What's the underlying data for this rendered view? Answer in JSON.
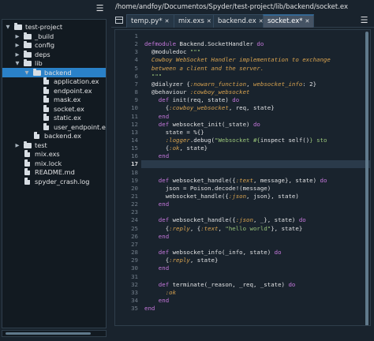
{
  "explorer": {
    "menu_icon": "hamburger-menu-icon",
    "tree": [
      {
        "label": "test-project",
        "depth": 0,
        "type": "folder",
        "expanded": true
      },
      {
        "label": "_build",
        "depth": 1,
        "type": "folder",
        "expanded": false
      },
      {
        "label": "config",
        "depth": 1,
        "type": "folder",
        "expanded": false
      },
      {
        "label": "deps",
        "depth": 1,
        "type": "folder",
        "expanded": false
      },
      {
        "label": "lib",
        "depth": 1,
        "type": "folder",
        "expanded": true
      },
      {
        "label": "backend",
        "depth": 2,
        "type": "folder",
        "expanded": true,
        "selected": true
      },
      {
        "label": "application.ex",
        "depth": 3,
        "type": "file"
      },
      {
        "label": "endpoint.ex",
        "depth": 3,
        "type": "file"
      },
      {
        "label": "mask.ex",
        "depth": 3,
        "type": "file"
      },
      {
        "label": "socket.ex",
        "depth": 3,
        "type": "file"
      },
      {
        "label": "static.ex",
        "depth": 3,
        "type": "file"
      },
      {
        "label": "user_endpoint.ex",
        "depth": 3,
        "type": "file"
      },
      {
        "label": "backend.ex",
        "depth": 2,
        "type": "file"
      },
      {
        "label": "test",
        "depth": 1,
        "type": "folder",
        "expanded": false
      },
      {
        "label": "mix.exs",
        "depth": 1,
        "type": "file"
      },
      {
        "label": "mix.lock",
        "depth": 1,
        "type": "file"
      },
      {
        "label": "README.md",
        "depth": 1,
        "type": "file"
      },
      {
        "label": "spyder_crash.log",
        "depth": 1,
        "type": "file"
      }
    ]
  },
  "editor": {
    "path": "/home/andfoy/Documentos/Spyder/test-project/lib/backend/socket.ex",
    "browse_icon": "browse-tabs-icon",
    "menu_icon": "hamburger-menu-icon",
    "tabs": [
      {
        "label": "temp.py*",
        "active": false
      },
      {
        "label": "mix.exs",
        "active": false
      },
      {
        "label": "backend.ex",
        "active": false
      },
      {
        "label": "socket.ex*",
        "active": true
      }
    ],
    "current_line": 17,
    "lines": [
      {
        "n": "1",
        "parts": []
      },
      {
        "n": "2",
        "parts": [
          [
            "defmodule ",
            "kw"
          ],
          [
            "Backend.SocketHandler ",
            "mod"
          ],
          [
            "do",
            "kw"
          ]
        ]
      },
      {
        "n": "3",
        "parts": [
          [
            "  @moduledoc ",
            "attr"
          ],
          [
            "\"\"\"",
            "str"
          ]
        ]
      },
      {
        "n": "4",
        "parts": [
          [
            "  Cowboy WebSocket Handler implementation to exchange",
            "doc"
          ]
        ]
      },
      {
        "n": "5",
        "parts": [
          [
            "  between a client and the server.",
            "doc"
          ]
        ]
      },
      {
        "n": "6",
        "parts": [
          [
            "  \"\"\"",
            "str"
          ]
        ]
      },
      {
        "n": "7",
        "parts": [
          [
            "  @dialyzer {",
            "attr"
          ],
          [
            ":nowarn_function",
            "atom"
          ],
          [
            ", ",
            "txt"
          ],
          [
            "websocket_info",
            "atom"
          ],
          [
            ": 2}",
            "txt"
          ]
        ]
      },
      {
        "n": "8",
        "parts": [
          [
            "  @behaviour ",
            "attr"
          ],
          [
            ":cowboy_websocket",
            "atom"
          ]
        ]
      },
      {
        "n": "9",
        "parts": [
          [
            "    def ",
            "kw"
          ],
          [
            "init(req, state) ",
            "txt"
          ],
          [
            "do",
            "kw"
          ]
        ]
      },
      {
        "n": "10",
        "parts": [
          [
            "      {",
            "txt"
          ],
          [
            ":cowboy_websocket",
            "atom"
          ],
          [
            ", req, state}",
            "txt"
          ]
        ]
      },
      {
        "n": "11",
        "parts": [
          [
            "    end",
            "kw"
          ]
        ]
      },
      {
        "n": "12",
        "parts": [
          [
            "    def ",
            "kw"
          ],
          [
            "websocket_init(_state) ",
            "txt"
          ],
          [
            "do",
            "kw"
          ]
        ]
      },
      {
        "n": "13",
        "parts": [
          [
            "      state = %{}",
            "txt"
          ]
        ]
      },
      {
        "n": "14",
        "parts": [
          [
            "      :logger",
            "atom"
          ],
          [
            ".debug(",
            "txt"
          ],
          [
            "\"Websocket #{",
            "str"
          ],
          [
            "inspect self()",
            "txt"
          ],
          [
            "} sto",
            "str"
          ]
        ]
      },
      {
        "n": "15",
        "parts": [
          [
            "      {",
            "txt"
          ],
          [
            ":ok",
            "atom"
          ],
          [
            ", state}",
            "txt"
          ]
        ]
      },
      {
        "n": "16",
        "parts": [
          [
            "    end",
            "kw"
          ]
        ]
      },
      {
        "n": "17",
        "parts": []
      },
      {
        "n": "18",
        "parts": []
      },
      {
        "n": "19",
        "parts": [
          [
            "    def ",
            "kw"
          ],
          [
            "websocket_handle({",
            "txt"
          ],
          [
            ":text",
            "atom"
          ],
          [
            ", message}, state) ",
            "txt"
          ],
          [
            "do",
            "kw"
          ]
        ]
      },
      {
        "n": "20",
        "parts": [
          [
            "      json = Poison.decode!(message)",
            "txt"
          ]
        ]
      },
      {
        "n": "21",
        "parts": [
          [
            "      websocket_handle({",
            "txt"
          ],
          [
            ":json",
            "atom"
          ],
          [
            ", json}, state)",
            "txt"
          ]
        ]
      },
      {
        "n": "22",
        "parts": [
          [
            "    end",
            "kw"
          ]
        ]
      },
      {
        "n": "23",
        "parts": []
      },
      {
        "n": "24",
        "parts": [
          [
            "    def ",
            "kw"
          ],
          [
            "websocket_handle({",
            "txt"
          ],
          [
            ":json",
            "atom"
          ],
          [
            ", _}, state) ",
            "txt"
          ],
          [
            "do",
            "kw"
          ]
        ]
      },
      {
        "n": "25",
        "parts": [
          [
            "      {",
            "txt"
          ],
          [
            ":reply",
            "atom"
          ],
          [
            ", {",
            "txt"
          ],
          [
            ":text",
            "atom"
          ],
          [
            ", ",
            "txt"
          ],
          [
            "\"hello world\"",
            "str"
          ],
          [
            "}, state}",
            "txt"
          ]
        ]
      },
      {
        "n": "26",
        "parts": [
          [
            "    end",
            "kw"
          ]
        ]
      },
      {
        "n": "27",
        "parts": []
      },
      {
        "n": "28",
        "parts": [
          [
            "    def ",
            "kw"
          ],
          [
            "websocket_info(_info, state) ",
            "txt"
          ],
          [
            "do",
            "kw"
          ]
        ]
      },
      {
        "n": "29",
        "parts": [
          [
            "      {",
            "txt"
          ],
          [
            ":reply",
            "atom"
          ],
          [
            ", state}",
            "txt"
          ]
        ]
      },
      {
        "n": "30",
        "parts": [
          [
            "    end",
            "kw"
          ]
        ]
      },
      {
        "n": "31",
        "parts": []
      },
      {
        "n": "32",
        "parts": [
          [
            "    def ",
            "kw"
          ],
          [
            "terminate(_reason, _req, _state) ",
            "txt"
          ],
          [
            "do",
            "kw"
          ]
        ]
      },
      {
        "n": "33",
        "parts": [
          [
            "      :ok",
            "atom"
          ]
        ]
      },
      {
        "n": "34",
        "parts": [
          [
            "    end",
            "kw"
          ]
        ]
      },
      {
        "n": "35",
        "parts": [
          [
            "end",
            "kw"
          ]
        ]
      }
    ],
    "colors": {
      "kw": "#c678dd",
      "mod": "#e0e1e3",
      "attr": "#e0e1e3",
      "str": "#98c379",
      "doc": "#d7a24f",
      "atom": "#d7a24f",
      "txt": "#e0e1e3"
    }
  }
}
